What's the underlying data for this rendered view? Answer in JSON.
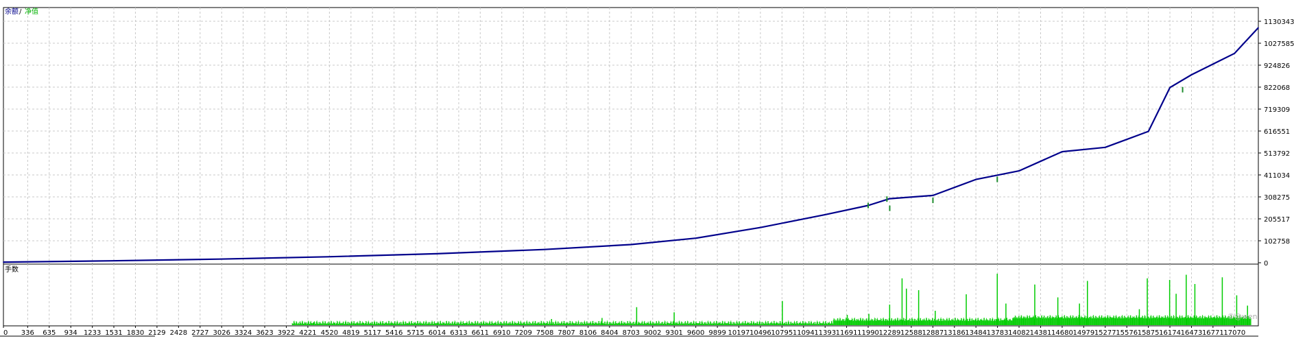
{
  "legend": {
    "balance": "余额",
    "separator": "/",
    "equity": "净值"
  },
  "volume_panel": {
    "label": "手数"
  },
  "watermark": "⑤@wen",
  "colors": {
    "balance_line": "#00008b",
    "equity_line": "#1e8c2e",
    "volume_bars": "#00cc00",
    "grid": "#c8c8c8",
    "frame": "#000000",
    "legend_balance": "#00008b",
    "legend_equity": "#00b000"
  },
  "chart_data": [
    {
      "type": "line",
      "grid": true,
      "y_axis_position": "right",
      "ylim": [
        0,
        1130343
      ],
      "yticks": [
        0,
        102758,
        205517,
        308275,
        411034,
        513792,
        616551,
        719309,
        822068,
        924826,
        1027585,
        1130343
      ],
      "ytick_labels": [
        "0",
        "102758",
        "205517",
        "308275",
        "411034",
        "513792",
        "616551",
        "719309",
        "822068",
        "924826",
        "1027585",
        "1130343"
      ],
      "xlim": [
        0,
        17400
      ],
      "series": [
        {
          "name": "余额",
          "x": [
            0,
            1500,
            3000,
            4500,
            6000,
            7500,
            8700,
            9600,
            10500,
            11393,
            11990,
            12289,
            12888,
            13484,
            14082,
            14680,
            15277,
            15876,
            16174,
            16473,
            17070,
            17400
          ],
          "values": [
            3000,
            9000,
            17000,
            28000,
            42000,
            62000,
            85000,
            115000,
            165000,
            225000,
            268000,
            300000,
            315000,
            390000,
            430000,
            520000,
            540000,
            615000,
            820000,
            880000,
            980000,
            1100000
          ]
        },
        {
          "name": "净值",
          "x": [
            11990,
            12250,
            12289,
            12888,
            13780,
            16350
          ],
          "values": [
            268000,
            298000,
            255000,
            292000,
            390000,
            810000
          ]
        }
      ]
    },
    {
      "type": "bar",
      "grid": true,
      "xlim": [
        0,
        17400
      ],
      "xticks": [
        0,
        336,
        635,
        934,
        1233,
        1531,
        1830,
        2129,
        2428,
        2727,
        3026,
        3324,
        3623,
        3922,
        4221,
        4520,
        4819,
        5117,
        5416,
        5715,
        6014,
        6313,
        6611,
        6910,
        7209,
        7508,
        7807,
        8106,
        8404,
        8703,
        9002,
        9301,
        9600,
        9899,
        10197,
        10496,
        10795,
        11094,
        11393,
        11691,
        11990,
        12289,
        12588,
        12887,
        13186,
        13484,
        13783,
        14082,
        14381,
        14680,
        14979,
        15277,
        15576,
        15875,
        16174,
        16473,
        16771,
        17070
      ],
      "xtick_labels": [
        "0",
        "336",
        "635",
        "934",
        "1233",
        "1531",
        "1830",
        "2129",
        "2428",
        "2727",
        "3026",
        "3324",
        "3623",
        "3922",
        "4221",
        "4520",
        "4819",
        "5117",
        "5416",
        "5715",
        "6014",
        "6313",
        "6611",
        "6910",
        "7209",
        "7508",
        "7807",
        "8106",
        "8404",
        "8703",
        "9002",
        "9301",
        "9600",
        "9899",
        "10197",
        "10496",
        "10795",
        "11094",
        "11393",
        "11691",
        "11990",
        "12289",
        "12588",
        "12887",
        "13186",
        "13484",
        "13783",
        "14082",
        "14381",
        "14680",
        "14979",
        "15277",
        "15576",
        "15875",
        "16174",
        "16473",
        "16771",
        "17070"
      ],
      "series": [
        {
          "name": "手数",
          "note_scale": "relative to tallest bar = 1.0",
          "x": [
            4300,
            7600,
            8300,
            8780,
            9300,
            10800,
            11700,
            12000,
            12288,
            12460,
            12520,
            12690,
            12920,
            13350,
            13780,
            13900,
            14300,
            14620,
            14920,
            15030,
            15750,
            15860,
            16170,
            16260,
            16400,
            16520,
            16900,
            17100,
            17250
          ],
          "values": [
            0.06,
            0.12,
            0.14,
            0.35,
            0.25,
            0.47,
            0.2,
            0.22,
            0.4,
            0.91,
            0.71,
            0.68,
            0.28,
            0.6,
            1.0,
            0.42,
            0.79,
            0.54,
            0.42,
            0.86,
            0.31,
            0.91,
            0.88,
            0.61,
            0.98,
            0.8,
            0.93,
            0.58,
            0.38
          ]
        }
      ]
    }
  ]
}
